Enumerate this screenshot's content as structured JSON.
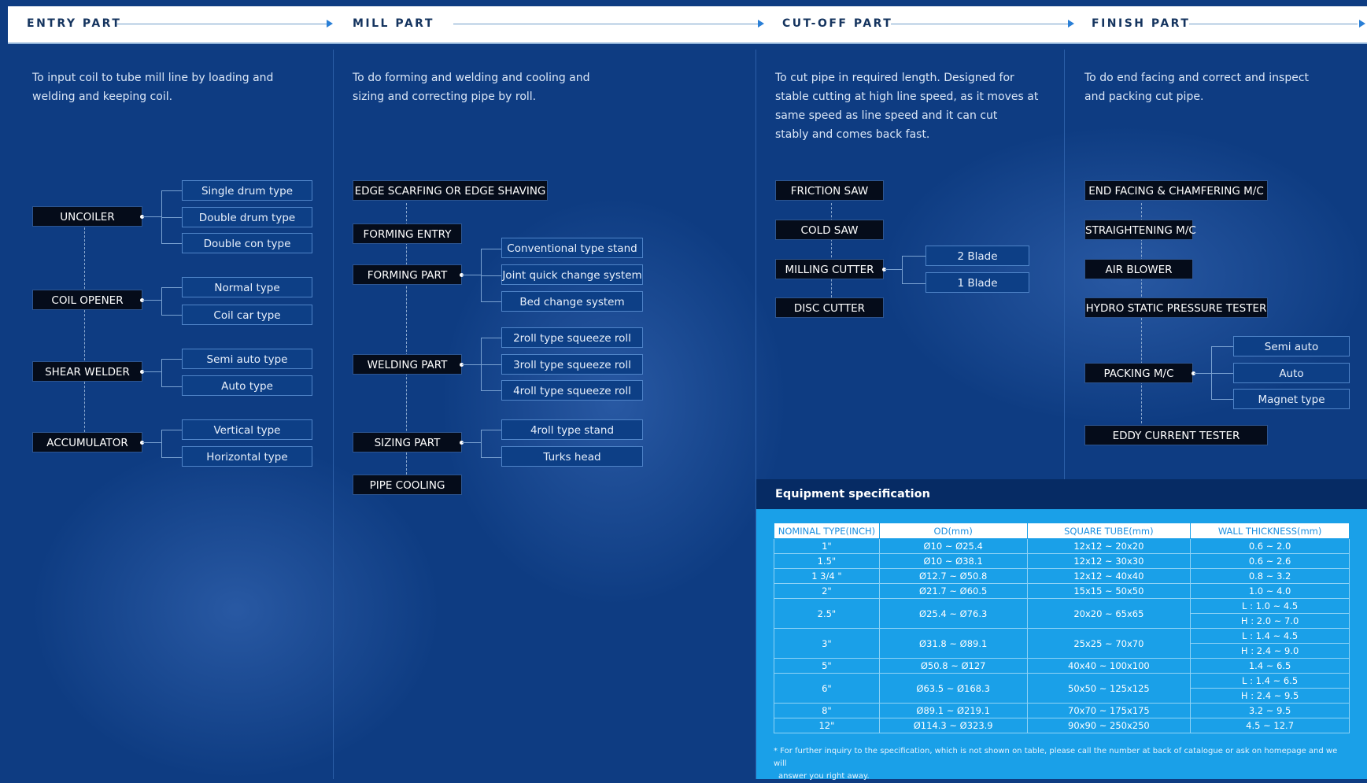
{
  "sections": [
    {
      "title": "ENTRY PART",
      "description": [
        "To input coil to tube mill line by loading and",
        "welding and keeping coil."
      ]
    },
    {
      "title": "MILL PART",
      "description": [
        "To do forming and welding and cooling and",
        "sizing and correcting pipe by roll."
      ]
    },
    {
      "title": "CUT-OFF PART",
      "description": [
        "To cut pipe in required length. Designed for",
        "stable cutting at high line speed, as it moves at",
        "same speed as line speed and it can cut",
        "stably and comes back fast."
      ]
    },
    {
      "title": "FINISH PART",
      "description": [
        "To do end facing and correct and inspect",
        "and packing cut pipe."
      ]
    }
  ],
  "entry": {
    "uncoiler": {
      "label": "UNCOILER",
      "options": [
        "Single drum type",
        "Double drum type",
        "Double con type"
      ]
    },
    "coil_opener": {
      "label": "COIL OPENER",
      "options": [
        "Normal type",
        "Coil car type"
      ]
    },
    "shear_welder": {
      "label": "SHEAR WELDER",
      "options": [
        "Semi auto type",
        "Auto type"
      ]
    },
    "accumulator": {
      "label": "ACCUMULATOR",
      "options": [
        "Vertical type",
        "Horizontal type"
      ]
    }
  },
  "mill": {
    "edge_scarfing": "EDGE SCARFING OR EDGE SHAVING",
    "forming_entry": "FORMING ENTRY",
    "forming_part": {
      "label": "FORMING PART",
      "options": [
        "Conventional type stand",
        "Joint quick change system",
        "Bed change system"
      ]
    },
    "welding_part": {
      "label": "WELDING PART",
      "options": [
        "2roll type squeeze roll",
        "3roll type squeeze roll",
        "4roll type squeeze roll"
      ]
    },
    "sizing_part": {
      "label": "SIZING PART",
      "options": [
        "4roll type stand",
        "Turks head"
      ]
    },
    "pipe_cooling": "PIPE COOLING"
  },
  "cutoff": {
    "friction_saw": "FRICTION SAW",
    "cold_saw": "COLD SAW",
    "milling_cutter": {
      "label": "MILLING CUTTER",
      "options": [
        "2 Blade",
        "1 Blade"
      ]
    },
    "disc_cutter": "DISC CUTTER"
  },
  "finish": {
    "end_facing": "END FACING & CHAMFERING M/C",
    "straightening": "STRAIGHTENING M/C",
    "air_blower": "AIR BLOWER",
    "hydro": "HYDRO STATIC PRESSURE TESTER",
    "packing": {
      "label": "PACKING M/C",
      "options": [
        "Semi auto",
        "Auto",
        "Magnet type"
      ]
    },
    "eddy": "EDDY CURRENT TESTER"
  },
  "spec": {
    "title": "Equipment specification",
    "headers": [
      "NOMINAL TYPE(INCH)",
      "OD(mm)",
      "SQUARE TUBE(mm)",
      "WALL THICKNESS(mm)"
    ],
    "rows": [
      {
        "nominal": "1\"",
        "od": "Ø10 ~ Ø25.4",
        "square": "12x12 ~ 20x20",
        "wall": [
          "0.6 ~ 2.0"
        ]
      },
      {
        "nominal": "1.5\"",
        "od": "Ø10 ~ Ø38.1",
        "square": "12x12 ~ 30x30",
        "wall": [
          "0.6 ~ 2.6"
        ]
      },
      {
        "nominal": "1 3/4 \"",
        "od": "Ø12.7 ~ Ø50.8",
        "square": "12x12 ~ 40x40",
        "wall": [
          "0.8 ~ 3.2"
        ]
      },
      {
        "nominal": "2\"",
        "od": "Ø21.7 ~ Ø60.5",
        "square": "15x15 ~ 50x50",
        "wall": [
          "1.0 ~ 4.0"
        ]
      },
      {
        "nominal": "2.5\"",
        "od": "Ø25.4 ~ Ø76.3",
        "square": "20x20 ~ 65x65",
        "wall": [
          "L : 1.0 ~ 4.5",
          "H : 2.0 ~ 7.0"
        ]
      },
      {
        "nominal": "3\"",
        "od": "Ø31.8 ~ Ø89.1",
        "square": "25x25 ~ 70x70",
        "wall": [
          "L : 1.4 ~ 4.5",
          "H : 2.4 ~ 9.0"
        ]
      },
      {
        "nominal": "5\"",
        "od": "Ø50.8 ~ Ø127",
        "square": "40x40 ~ 100x100",
        "wall": [
          "1.4 ~ 6.5"
        ]
      },
      {
        "nominal": "6\"",
        "od": "Ø63.5 ~ Ø168.3",
        "square": "50x50 ~ 125x125",
        "wall": [
          "L : 1.4 ~ 6.5",
          "H : 2.4 ~ 9.5"
        ]
      },
      {
        "nominal": "8\"",
        "od": "Ø89.1 ~ Ø219.1",
        "square": "70x70 ~ 175x175",
        "wall": [
          "3.2 ~ 9.5"
        ]
      },
      {
        "nominal": "12\"",
        "od": "Ø114.3 ~ Ø323.9",
        "square": "90x90 ~ 250x250",
        "wall": [
          "4.5 ~ 12.7"
        ]
      }
    ],
    "footnote": [
      "* For further inquiry to the specification, which is not shown on table, please call the number at back of catalogue or ask on homepage and we will",
      "answer you right away."
    ]
  }
}
